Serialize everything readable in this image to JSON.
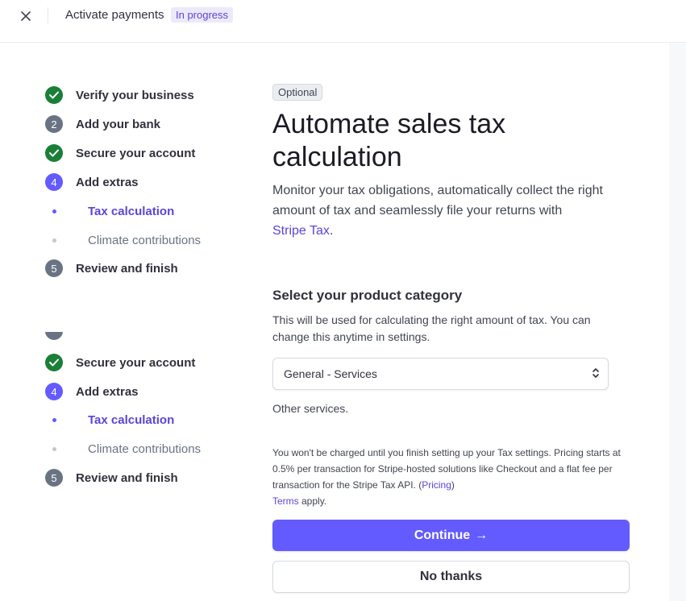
{
  "header": {
    "title": "Activate payments",
    "status": "In progress"
  },
  "steps_primary": [
    {
      "label": "Verify your business",
      "state": "done"
    },
    {
      "label": "Add your bank",
      "state": "number",
      "number": "2"
    },
    {
      "label": "Secure your account",
      "state": "done"
    },
    {
      "label": "Add extras",
      "state": "current",
      "number": "4"
    },
    {
      "label": "Tax calculation",
      "state": "sub-active"
    },
    {
      "label": "Climate contributions",
      "state": "sub-inactive"
    },
    {
      "label": "Review and finish",
      "state": "number",
      "number": "5"
    }
  ],
  "steps_secondary": [
    {
      "label": "Secure your account",
      "state": "done"
    },
    {
      "label": "Add extras",
      "state": "current",
      "number": "4"
    },
    {
      "label": "Tax calculation",
      "state": "sub-active"
    },
    {
      "label": "Climate contributions",
      "state": "sub-inactive"
    },
    {
      "label": "Review and finish",
      "state": "number",
      "number": "5"
    }
  ],
  "main": {
    "badge": "Optional",
    "title": "Automate sales tax calculation",
    "description": "Monitor your tax obligations, automatically collect the right amount of tax and seamlessly file your returns with",
    "description_link": "Stripe Tax",
    "description_end": ".",
    "section_title": "Select your product category",
    "section_desc": "This will be used for calculating the right amount of tax. You can change this anytime in settings.",
    "select_value": "General - Services",
    "select_hint": "Other services.",
    "fineprint": "You won't be charged until you finish setting up your Tax settings. Pricing starts at 0.5% per transaction for Stripe-hosted solutions like Checkout and a flat fee per transaction for the Stripe Tax API. (",
    "fineprint_pricing_link": "Pricing",
    "fineprint_close": ")",
    "terms_link": "Terms",
    "terms_suffix": " apply.",
    "continue_label": "Continue",
    "continue_arrow": "→",
    "no_thanks_label": "No thanks"
  },
  "colors": {
    "accent": "#635bff",
    "accent_text": "#5b45d6",
    "success": "#1a7f37",
    "muted": "#6a7383"
  }
}
